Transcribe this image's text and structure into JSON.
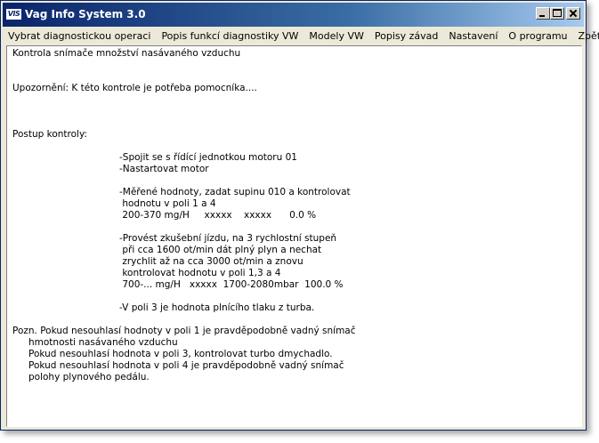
{
  "window": {
    "logo_text": "VIS",
    "title": "Vag Info System 3.0"
  },
  "menu": [
    "Vybrat diagnostickou operaci",
    "Popis funkcí diagnostiky VW",
    "Modely VW",
    "Popisy závad",
    "Nastavení",
    "O programu",
    "Zpět"
  ],
  "document": {
    "heading": "Kontrola snímače množství nasávaného vzduchu",
    "warning": "Upozornění: K této kontrole je potřeba pomocníka....",
    "procedure_label": "Postup kontroly:",
    "steps": [
      "-Spojit se s řídící jednotkou motoru 01",
      "-Nastartovat motor",
      "-Měřené hodnoty, zadat supinu 010 a kontrolovat",
      " hodnotu v poli 1 a 4",
      " 200-370 mg/H     xxxxx    xxxxx      0.0 %",
      "-Provést zkušební jízdu, na 3 rychlostní stupeň",
      " při cca 1600 ot/min dát plný plyn a nechat",
      " zrychlit až na cca 3000 ot/min a znovu",
      " kontrolovat hodnotu v poli 1,3 a 4",
      " 700-... mg/H   xxxxx  1700-2080mbar  100.0 %",
      "-V poli 3 je hodnota plnícího tlaku z turba."
    ],
    "notes": [
      "Pozn. Pokud nesouhlasí hodnoty v poli 1 je pravděpodobně vadný snímač",
      "hmotnosti nasávaného vzduchu",
      "Pokud nesouhlasí hodnota v poli 3, kontrolovat turbo dmychadlo.",
      "Pokud nesouhlasí hodnota v poli 4 je pravděpodobně vadný snímač",
      "polohy plynového pedálu."
    ]
  }
}
